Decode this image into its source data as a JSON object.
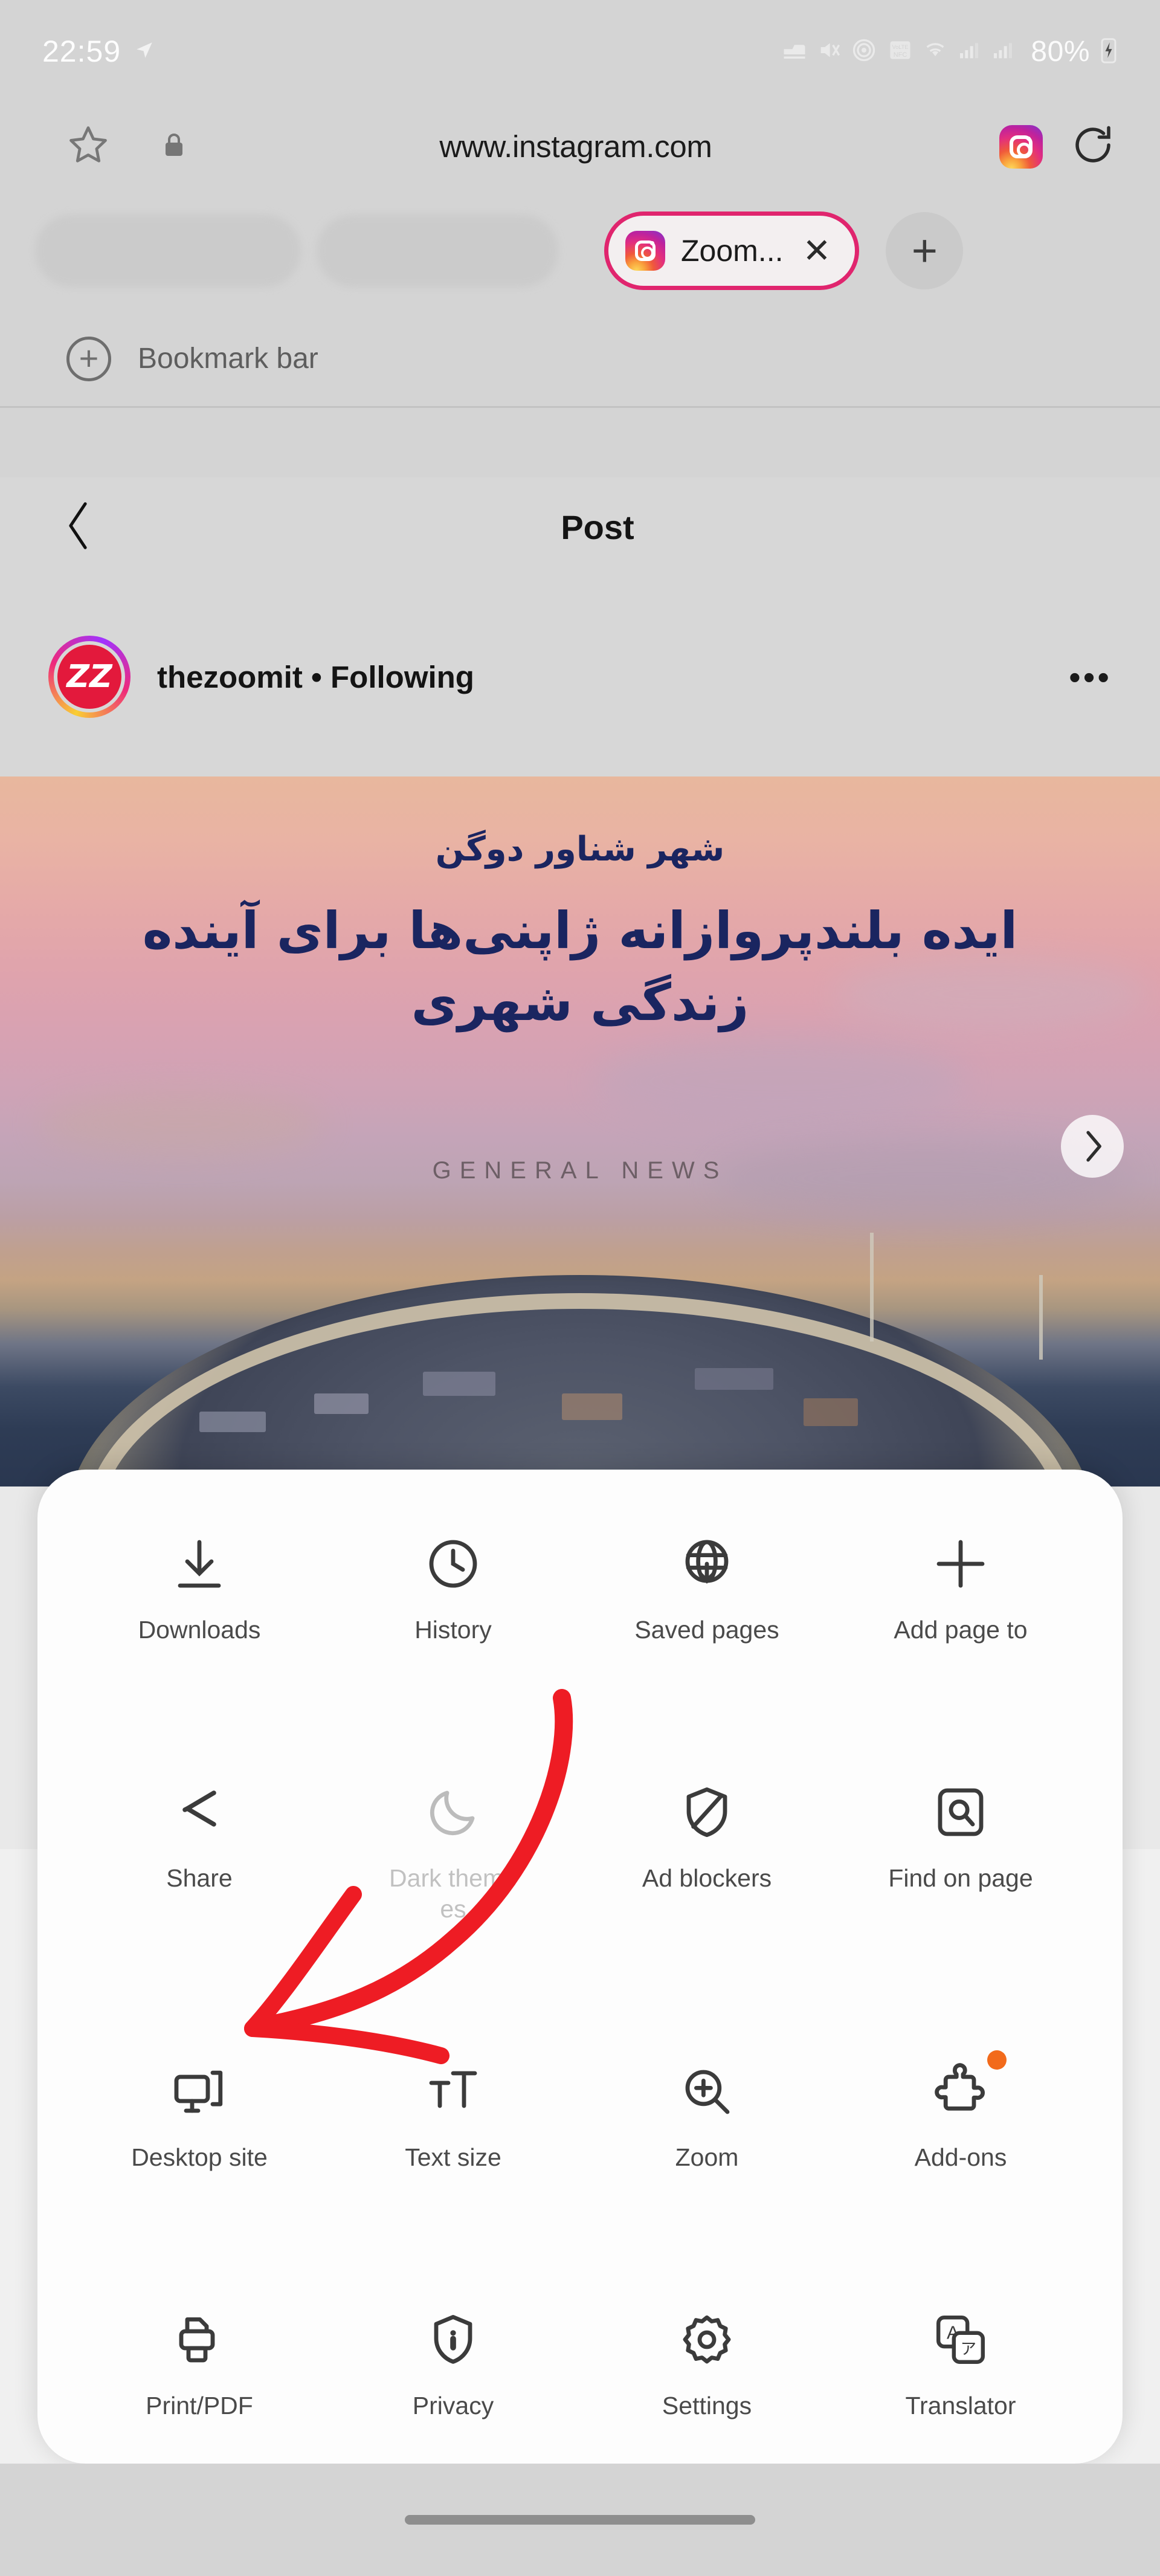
{
  "status_bar": {
    "time": "22:59",
    "battery": "80%",
    "icons": [
      "location-arrow-icon",
      "bed-icon",
      "mute-icon",
      "hotspot-icon",
      "nfc-icon",
      "wifi-icon",
      "signal-bars-icon",
      "signal-bars-icon-2",
      "battery-icon"
    ]
  },
  "url_bar": {
    "url": "www.instagram.com",
    "bookmark_icon": "star-icon",
    "security_icon": "lock-icon",
    "site_icon": "instagram-favicon",
    "reload_icon": "reload-icon"
  },
  "tab_strip": {
    "active_tab_label": "Zoom...",
    "close_icon": "close-icon",
    "new_tab_label": "+"
  },
  "bookmark_bar": {
    "label": "Bookmark bar",
    "add_icon": "plus-circle-icon"
  },
  "instagram": {
    "header_title": "Post",
    "back_icon": "chevron-left-icon",
    "account_name": "thezoomit",
    "account_separator": "•",
    "follow_state": "Following",
    "avatar_initials": "ZZ",
    "more_icon": "ellipsis-icon",
    "post": {
      "subtitle_fa": "شهر شناور دوگن",
      "headline_fa": "ایده بلندپروازانه ژاپنی‌ها برای آینده زندگی شهری",
      "kicker": "GENERAL NEWS",
      "next_slide_icon": "chevron-right-icon"
    }
  },
  "menu_sheet": {
    "rows": [
      [
        {
          "label": "Downloads",
          "icon": "download-icon",
          "disabled": false,
          "badge": false
        },
        {
          "label": "History",
          "icon": "clock-icon",
          "disabled": false,
          "badge": false
        },
        {
          "label": "Saved pages",
          "icon": "globe-down-icon",
          "disabled": false,
          "badge": false
        },
        {
          "label": "Add page to",
          "icon": "plus-icon",
          "disabled": false,
          "badge": false
        }
      ],
      [
        {
          "label": "Share",
          "icon": "share-icon",
          "disabled": false,
          "badge": false
        },
        {
          "label": "Dark theme\nes",
          "icon": "moon-icon",
          "disabled": true,
          "badge": false
        },
        {
          "label": "Ad blockers",
          "icon": "shield-slash-icon",
          "disabled": false,
          "badge": false
        },
        {
          "label": "Find on page",
          "icon": "find-page-icon",
          "disabled": false,
          "badge": false
        }
      ],
      [
        {
          "label": "Desktop site",
          "icon": "monitor-icon",
          "disabled": false,
          "badge": false
        },
        {
          "label": "Text size",
          "icon": "text-size-icon",
          "disabled": false,
          "badge": false
        },
        {
          "label": "Zoom",
          "icon": "zoom-in-icon",
          "disabled": false,
          "badge": false
        },
        {
          "label": "Add-ons",
          "icon": "puzzle-icon",
          "disabled": false,
          "badge": true
        }
      ],
      [
        {
          "label": "Print/PDF",
          "icon": "printer-icon",
          "disabled": false,
          "badge": false
        },
        {
          "label": "Privacy",
          "icon": "shield-dot-icon",
          "disabled": false,
          "badge": false
        },
        {
          "label": "Settings",
          "icon": "gear-icon",
          "disabled": false,
          "badge": false
        },
        {
          "label": "Translator",
          "icon": "translate-icon",
          "disabled": false,
          "badge": false
        }
      ]
    ]
  },
  "annotation": {
    "type": "hand-drawn-arrow",
    "color": "#ee1c24",
    "points_at": "Desktop site"
  },
  "colors": {
    "chrome_bg": "#d4d4d4",
    "sheet_bg": "#fdfdfd",
    "accent_tab": "#e0256e",
    "annotation_red": "#ee1c24",
    "badge_orange": "#f26a1b",
    "avatar_red": "#e3193c"
  }
}
